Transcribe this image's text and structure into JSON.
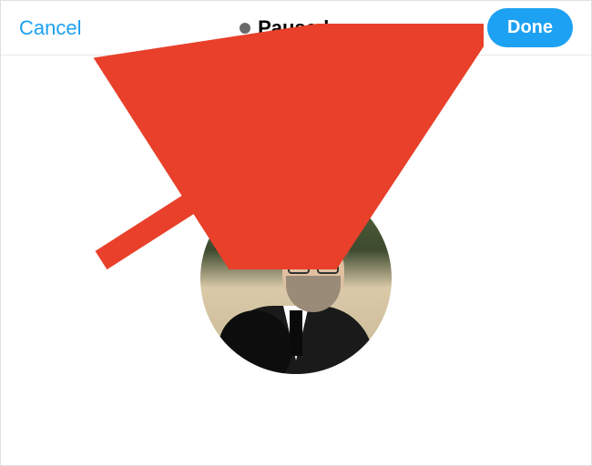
{
  "header": {
    "cancel_label": "Cancel",
    "status_label": "Paused",
    "done_label": "Done"
  },
  "colors": {
    "accent": "#1DA1F2",
    "annotation": "#E8402A"
  },
  "avatar": {
    "description": "profile-photo"
  }
}
